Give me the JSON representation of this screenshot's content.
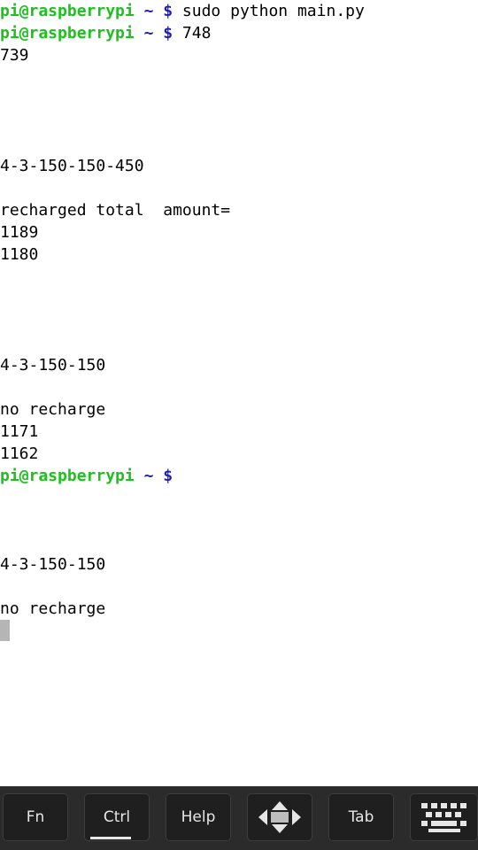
{
  "terminal": {
    "prompt_user": "pi@raspberrypi",
    "prompt_symbol": "~ $",
    "lines": [
      {
        "type": "prompt",
        "command": "sudo python main.py"
      },
      {
        "type": "prompt",
        "command": "748"
      },
      {
        "type": "text",
        "text": "739"
      },
      {
        "type": "text",
        "text": ""
      },
      {
        "type": "text",
        "text": ""
      },
      {
        "type": "text",
        "text": ""
      },
      {
        "type": "text",
        "text": ""
      },
      {
        "type": "text",
        "text": "4-3-150-150-450"
      },
      {
        "type": "text",
        "text": ""
      },
      {
        "type": "text",
        "text": "recharged total  amount="
      },
      {
        "type": "text",
        "text": "1189"
      },
      {
        "type": "text",
        "text": "1180"
      },
      {
        "type": "text",
        "text": ""
      },
      {
        "type": "text",
        "text": ""
      },
      {
        "type": "text",
        "text": ""
      },
      {
        "type": "text",
        "text": ""
      },
      {
        "type": "text",
        "text": "4-3-150-150"
      },
      {
        "type": "text",
        "text": ""
      },
      {
        "type": "text",
        "text": "no recharge"
      },
      {
        "type": "text",
        "text": "1171"
      },
      {
        "type": "text",
        "text": "1162"
      },
      {
        "type": "prompt",
        "command": ""
      },
      {
        "type": "text",
        "text": ""
      },
      {
        "type": "text",
        "text": ""
      },
      {
        "type": "text",
        "text": ""
      },
      {
        "type": "text",
        "text": "4-3-150-150"
      },
      {
        "type": "text",
        "text": ""
      },
      {
        "type": "text",
        "text": "no recharge"
      },
      {
        "type": "cursor"
      }
    ]
  },
  "toolbar": {
    "fn_label": "Fn",
    "ctrl_label": "Ctrl",
    "help_label": "Help",
    "arrows_icon": "dpad-arrows-icon",
    "tab_label": "Tab",
    "keyboard_icon": "keyboard-icon"
  },
  "colors": {
    "prompt_user": "#1bc21b",
    "prompt_symbol": "#1b1bc2",
    "toolbar_bg": "#2b2b2b",
    "key_bg": "#1f1f1f",
    "cursor": "#b5b5b5"
  }
}
